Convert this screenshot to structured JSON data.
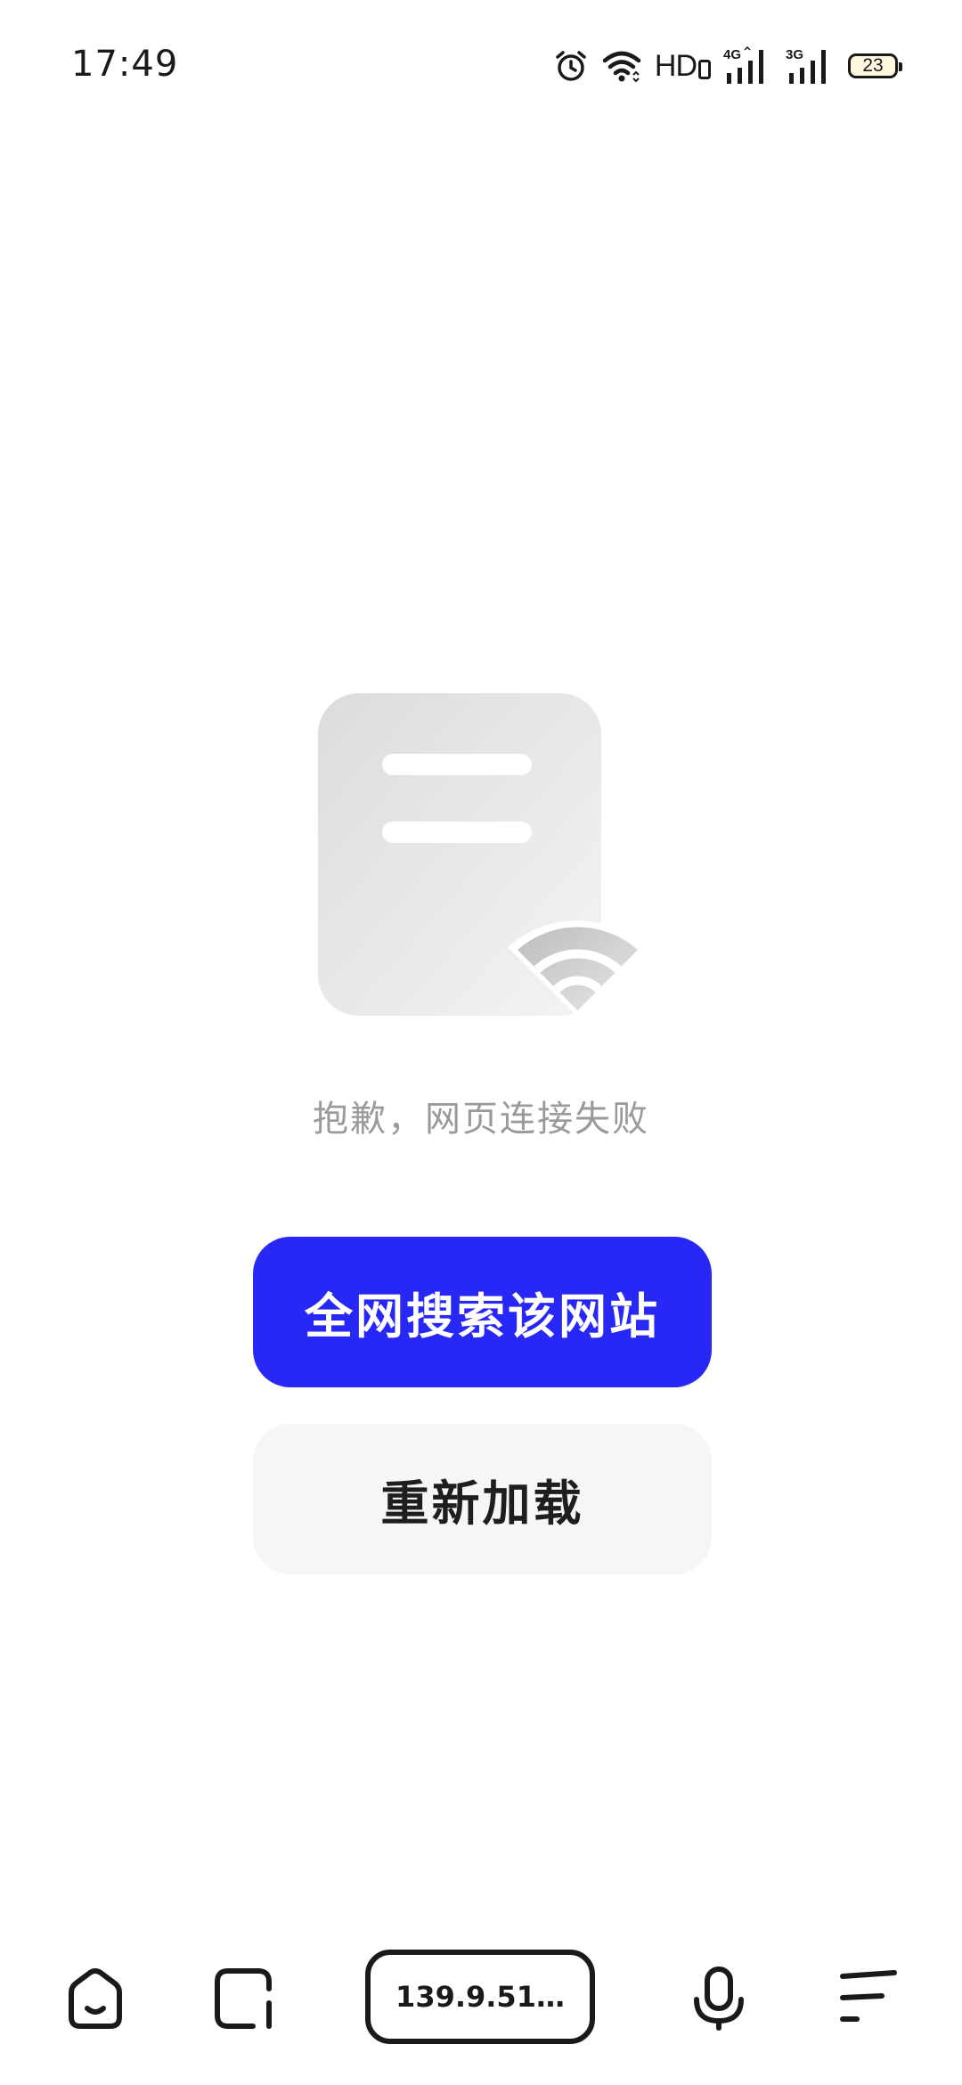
{
  "status_bar": {
    "time": "17:49",
    "hd_label": "HD",
    "network_1": "4G",
    "network_2": "3G",
    "battery_level": "23",
    "icons": [
      "alarm-icon",
      "wifi-icon",
      "hd-voice-icon",
      "signal-4g-icon",
      "signal-3g-icon",
      "battery-icon"
    ]
  },
  "error_page": {
    "illustration": "page-no-connection-icon",
    "message": "抱歉，网页连接失败",
    "search_button_label": "全网搜索该网站",
    "reload_button_label": "重新加载"
  },
  "toolbar": {
    "url_text": "139.9.51…",
    "icons": [
      "home-icon",
      "tabs-icon",
      "microphone-icon",
      "menu-icon"
    ]
  },
  "colors": {
    "primary_button": "#2828f6",
    "secondary_button": "#f6f6f6",
    "message_text": "#9a9a9a",
    "icon_dark": "#1a1a1a"
  }
}
